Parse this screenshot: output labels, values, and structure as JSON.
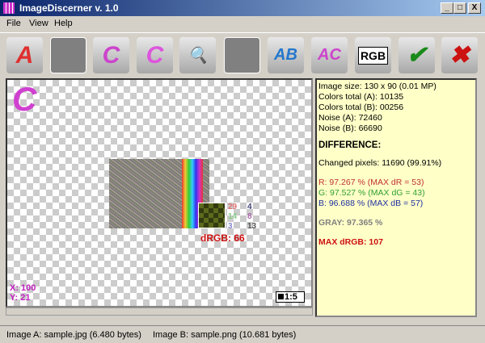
{
  "window": {
    "title": "ImageDiscerner v. 1.0",
    "controls": [
      "_",
      "□",
      "X"
    ]
  },
  "menu": [
    "File",
    "View",
    "Help"
  ],
  "toolbar": [
    {
      "icon": "open-image-a-icon",
      "glyph": "A",
      "color": "#e03030"
    },
    {
      "icon": "disabled-slot",
      "glyph": "",
      "color": ""
    },
    {
      "icon": "save-c-icon",
      "glyph": "C",
      "color": "#cc44cc"
    },
    {
      "icon": "magic-c-icon",
      "glyph": "C",
      "color": "#dd55dd"
    },
    {
      "icon": "zoom-in-icon",
      "glyph": "🔍",
      "color": "#2a6"
    },
    {
      "icon": "disabled-slot",
      "glyph": "",
      "color": ""
    },
    {
      "icon": "swap-ab-icon",
      "glyph": "AB",
      "color": "#2277cc"
    },
    {
      "icon": "swap-ac-icon",
      "glyph": "AC",
      "color": "#cc44cc"
    },
    {
      "icon": "rgb-histogram-icon",
      "glyph": "RGB",
      "color": "#000"
    },
    {
      "icon": "checkbox-check-icon",
      "glyph": "✔",
      "color": "#1a8a1a"
    },
    {
      "icon": "close-red-x-icon",
      "glyph": "✖",
      "color": "#cc1111"
    }
  ],
  "canvas": {
    "mode_letter": "C",
    "x_label": "X: 100",
    "y_label": "Y: 21",
    "zoom": "1:5",
    "pixel_values": {
      "r": [
        "29",
        "4"
      ],
      "g": [
        "14",
        "8"
      ],
      "b": [
        "3",
        "13"
      ]
    },
    "drgb": "dRGB: 66"
  },
  "info": {
    "image_size": "Image size: 130 x 90  (0.01 MP)",
    "colors_a": "Colors total (A): 10135",
    "colors_b": "Colors total (B): 00256",
    "noise_a": "Noise (A): 72460",
    "noise_b": "Noise (B): 66690",
    "difference": "DIFFERENCE:",
    "changed": "Changed pixels: 11690 (99.91%)",
    "r": "R: 97.267 % (MAX dR = 53)",
    "g": "G: 97.527 % (MAX dG = 43)",
    "b": "B: 96.688 % (MAX dB = 57)",
    "gray": "GRAY: 97.365 %",
    "max_drgb": "MAX dRGB: 107"
  },
  "status": {
    "image_a": "Image A:  sample.jpg (6.480 bytes)",
    "image_b": "Image B:  sample.png (10.681 bytes)"
  }
}
